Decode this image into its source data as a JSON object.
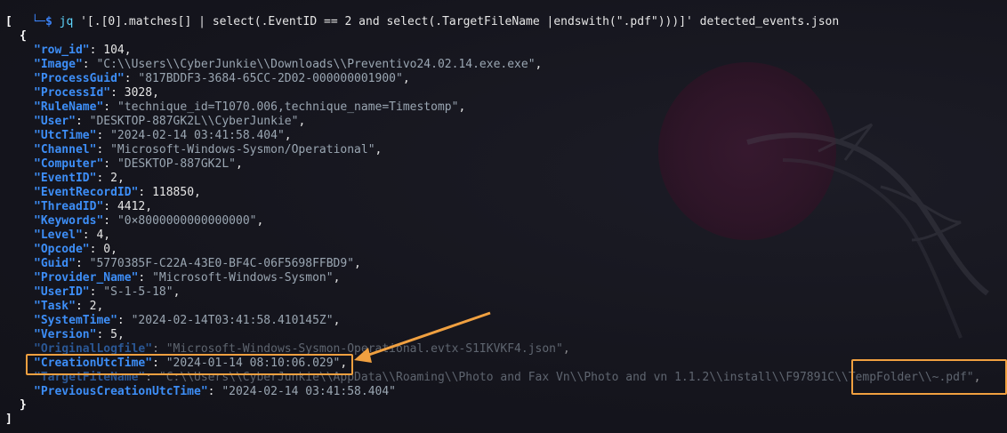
{
  "prompt": {
    "corner": "└─",
    "dollar": "$",
    "command_name": "jq",
    "command_args": " '[.[0].matches[] | select(.EventID == 2 and select(.TargetFileName |endswith(\".pdf\")))]' detected_events.json"
  },
  "output": {
    "open_array": "[",
    "open_object": "{",
    "close_object": "}",
    "close_array": "]",
    "fields": [
      {
        "key": "\"row_id\"",
        "value": "104",
        "type": "num"
      },
      {
        "key": "\"Image\"",
        "value": "\"C:\\\\Users\\\\CyberJunkie\\\\Downloads\\\\Preventivo24.02.14.exe.exe\"",
        "type": "str"
      },
      {
        "key": "\"ProcessGuid\"",
        "value": "\"817BDDF3-3684-65CC-2D02-000000001900\"",
        "type": "str"
      },
      {
        "key": "\"ProcessId\"",
        "value": "3028",
        "type": "num"
      },
      {
        "key": "\"RuleName\"",
        "value": "\"technique_id=T1070.006,technique_name=Timestomp\"",
        "type": "str"
      },
      {
        "key": "\"User\"",
        "value": "\"DESKTOP-887GK2L\\\\CyberJunkie\"",
        "type": "str"
      },
      {
        "key": "\"UtcTime\"",
        "value": "\"2024-02-14 03:41:58.404\"",
        "type": "str"
      },
      {
        "key": "\"Channel\"",
        "value": "\"Microsoft-Windows-Sysmon/Operational\"",
        "type": "str"
      },
      {
        "key": "\"Computer\"",
        "value": "\"DESKTOP-887GK2L\"",
        "type": "str"
      },
      {
        "key": "\"EventID\"",
        "value": "2",
        "type": "num"
      },
      {
        "key": "\"EventRecordID\"",
        "value": "118850",
        "type": "num"
      },
      {
        "key": "\"ThreadID\"",
        "value": "4412",
        "type": "num"
      },
      {
        "key": "\"Keywords\"",
        "value": "\"0×8000000000000000\"",
        "type": "str"
      },
      {
        "key": "\"Level\"",
        "value": "4",
        "type": "num"
      },
      {
        "key": "\"Opcode\"",
        "value": "0",
        "type": "num"
      },
      {
        "key": "\"Guid\"",
        "value": "\"5770385F-C22A-43E0-BF4C-06F5698FFBD9\"",
        "type": "str"
      },
      {
        "key": "\"Provider_Name\"",
        "value": "\"Microsoft-Windows-Sysmon\"",
        "type": "str"
      },
      {
        "key": "\"UserID\"",
        "value": "\"S-1-5-18\"",
        "type": "str"
      },
      {
        "key": "\"Task\"",
        "value": "2",
        "type": "num"
      },
      {
        "key": "\"SystemTime\"",
        "value": "\"2024-02-14T03:41:58.410145Z\"",
        "type": "str"
      },
      {
        "key": "\"Version\"",
        "value": "5",
        "type": "num"
      },
      {
        "key": "\"OriginalLogfile\"",
        "value": "\"Microsoft-Windows-Sysmon-Operational.evtx-S1IKVKF4.json\"",
        "type": "str"
      },
      {
        "key": "\"CreationUtcTime\"",
        "value": "\"2024-01-14 08:10:06.029\"",
        "type": "str"
      },
      {
        "key": "\"TargetFileName\"",
        "value": "\"C:\\\\Users\\\\CyberJunkie\\\\AppData\\\\Roaming\\\\Photo and Fax Vn\\\\Photo and vn 1.1.2\\\\install\\\\F97891C\\\\TempFolder\\\\~.pdf\"",
        "type": "str"
      },
      {
        "key": "\"PreviousCreationUtcTime\"",
        "value": "\"2024-02-14 03:41:58.404\"",
        "type": "str"
      }
    ]
  },
  "colors": {
    "background": "#16161e",
    "key": "#3d8ef7",
    "string": "#9aa6b2",
    "highlight": "#f0a040",
    "prompt": "#3b82f6"
  }
}
